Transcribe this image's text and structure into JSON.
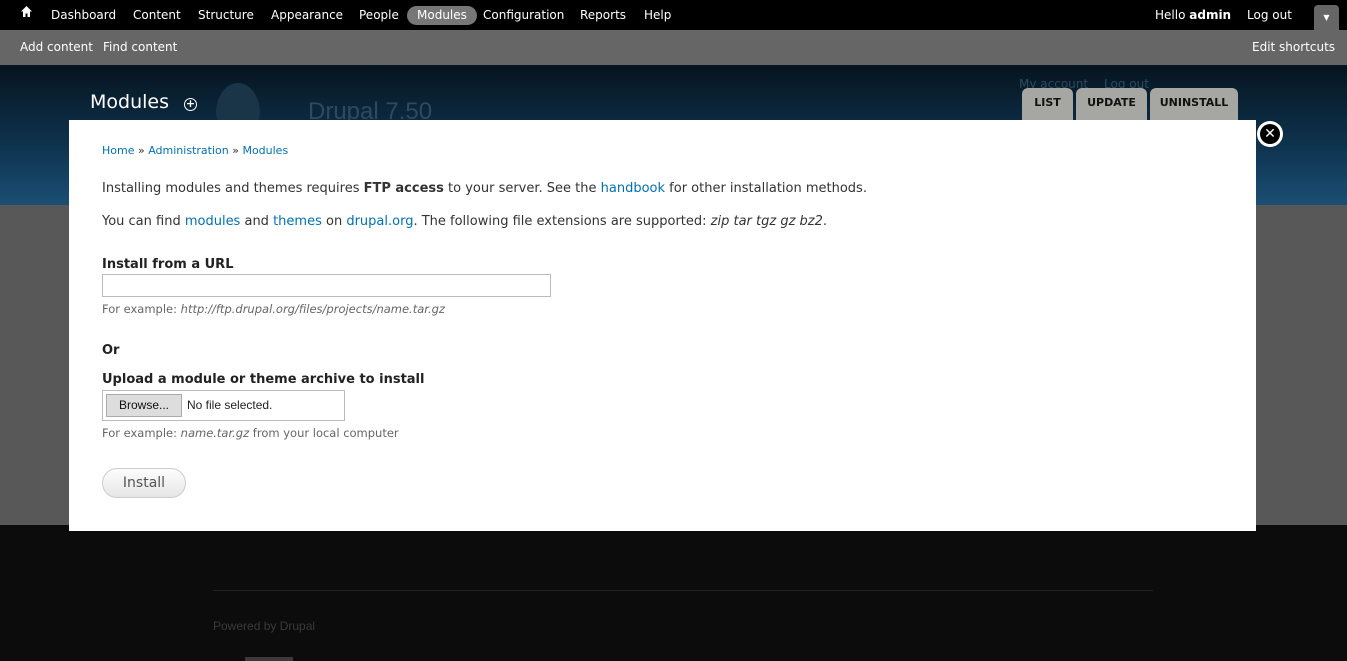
{
  "toolbar": {
    "items": [
      "Dashboard",
      "Content",
      "Structure",
      "Appearance",
      "People",
      "Modules",
      "Configuration",
      "Reports",
      "Help"
    ],
    "active": "Modules",
    "hello": "Hello",
    "user": "admin",
    "logout": "Log out"
  },
  "shortcuts": {
    "add": "Add content",
    "find": "Find content",
    "edit": "Edit shortcuts"
  },
  "header": {
    "title": "Modules",
    "site_name": "Drupal 7.50",
    "my_account": "My account",
    "log_out": "Log out",
    "tabs": [
      "LIST",
      "UPDATE",
      "UNINSTALL"
    ]
  },
  "modal": {
    "breadcrumb": [
      "Home",
      "Administration",
      "Modules"
    ],
    "intro1": {
      "a": "Installing modules and themes requires ",
      "b": "FTP access",
      "c": " to your server. See the ",
      "link": "handbook",
      "d": " for other installation methods."
    },
    "intro2": {
      "a": "You can find ",
      "modules": "modules",
      "and": " and ",
      "themes": "themes",
      "on": " on ",
      "drupal": "drupal.org",
      "b": ". The following file extensions are supported: ",
      "ext": "zip tar tgz gz bz2",
      "end": "."
    },
    "url_label": "Install from a URL",
    "url_value": "",
    "url_desc": "For example: ",
    "url_example": "http://ftp.drupal.org/files/projects/name.tar.gz",
    "or": "Or",
    "upload_label": "Upload a module or theme archive to install",
    "browse": "Browse...",
    "no_file": "No file selected.",
    "upload_desc": "For example: ",
    "upload_example": "name.tar.gz",
    "upload_desc2": " from your local computer",
    "install": "Install"
  },
  "footer": {
    "powered": "Powered by ",
    "drupal": "Drupal"
  }
}
